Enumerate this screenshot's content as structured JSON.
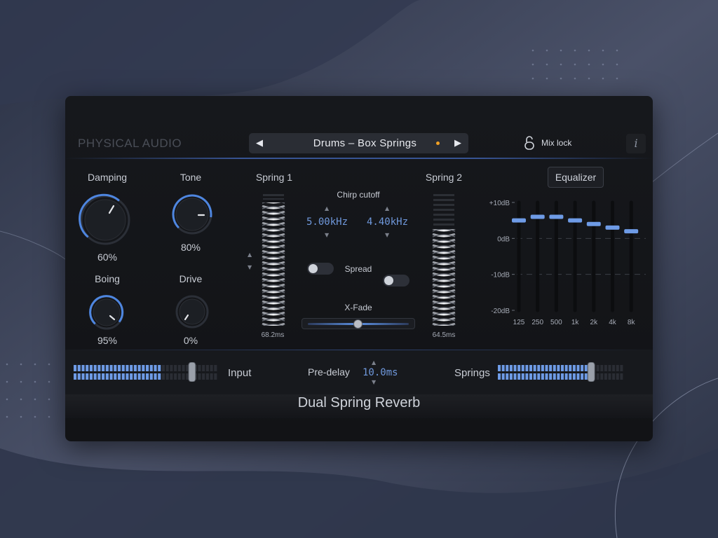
{
  "brand": "PHYSICAL AUDIO",
  "preset": {
    "prev": "◀",
    "name": "Drums – Box Springs",
    "next": "▶",
    "modified_color": "#f0a024"
  },
  "mix_lock": {
    "label": "Mix lock"
  },
  "info": {
    "label": "i"
  },
  "knobs": {
    "damping": {
      "label": "Damping",
      "value": "60%",
      "level": 0.6
    },
    "tone": {
      "label": "Tone",
      "value": "80%",
      "level": 0.8
    },
    "boing": {
      "label": "Boing",
      "value": "95%",
      "level": 0.95
    },
    "drive": {
      "label": "Drive",
      "value": "0%",
      "level": 0.0
    }
  },
  "spring1": {
    "label": "Spring 1",
    "time": "68.2ms"
  },
  "spring2": {
    "label": "Spring 2",
    "time": "64.5ms"
  },
  "chirp": {
    "label": "Chirp cutoff",
    "left": "5.00kHz",
    "right": "4.40kHz"
  },
  "spread": {
    "label": "Spread",
    "left_on": false,
    "right_on": false
  },
  "xfade": {
    "label": "X-Fade",
    "position": 0.5
  },
  "equalizer": {
    "button": "Equalizer",
    "scale": [
      "+10dB",
      "0dB",
      "-10dB",
      "-20dB"
    ],
    "bands": [
      {
        "label": "125",
        "gain_db": 5
      },
      {
        "label": "250",
        "gain_db": 6
      },
      {
        "label": "500",
        "gain_db": 6
      },
      {
        "label": "1k",
        "gain_db": 5
      },
      {
        "label": "2k",
        "gain_db": 4
      },
      {
        "label": "4k",
        "gain_db": 3
      },
      {
        "label": "8k",
        "gain_db": 2
      }
    ]
  },
  "input": {
    "label": "Input",
    "level": 0.6
  },
  "predelay": {
    "label": "Pre-delay",
    "value": "10.0ms"
  },
  "springs_out": {
    "label": "Springs",
    "level": 0.72
  },
  "plugin_title": "Dual Spring Reverb",
  "colors": {
    "accent": "#5b8fe0",
    "meter_on": "#6e9be6",
    "panel": "#141519"
  }
}
